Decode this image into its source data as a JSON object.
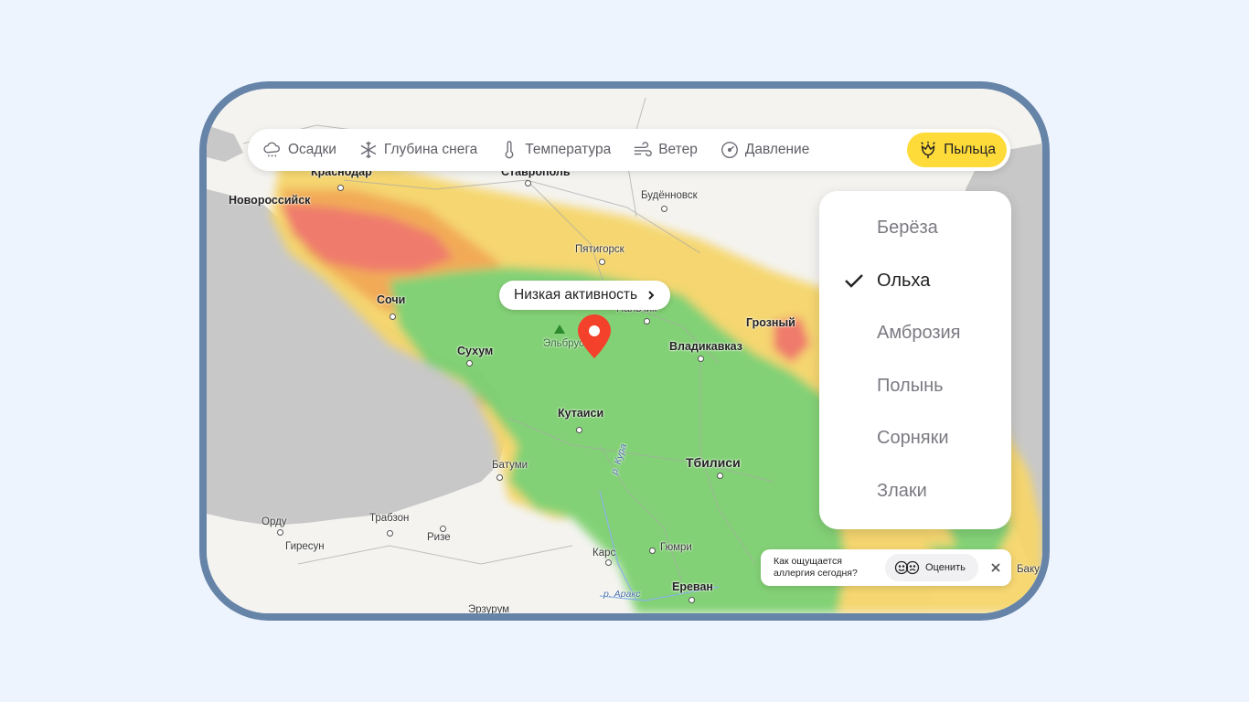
{
  "layers": [
    {
      "label": "Осадки",
      "icon": "cloud-rain-icon"
    },
    {
      "label": "Глубина снега",
      "icon": "snowflake-icon"
    },
    {
      "label": "Температура",
      "icon": "thermometer-icon"
    },
    {
      "label": "Ветер",
      "icon": "wind-icon"
    },
    {
      "label": "Давление",
      "icon": "gauge-icon"
    },
    {
      "label": "Пыльца",
      "icon": "pollen-flower-icon",
      "active": true
    }
  ],
  "popup": {
    "label": "Низкая активность"
  },
  "pollen_menu": {
    "items": [
      "Берёза",
      "Ольха",
      "Амброзия",
      "Полынь",
      "Сорняки",
      "Злаки"
    ],
    "selected": "Ольха"
  },
  "feedback": {
    "question": "Как ощущается аллергия сегодня?",
    "button": "Оценить"
  },
  "map_labels": {
    "krasnodar": "Краснодар",
    "stavropol": "Ставрополь",
    "novorossiysk": "Новороссийск",
    "budennovsk": "Будённовск",
    "pyatigorsk": "Пятигорск",
    "sochi": "Сочи",
    "nalchik": "Нальчик",
    "grozny": "Грозный",
    "elbrus": "Эльбрус",
    "vladikavkaz": "Владикавказ",
    "sukhum": "Сухум",
    "kutaisi": "Кутаиси",
    "tbilisi": "Тбилиси",
    "batumi": "Батуми",
    "ordu": "Орду",
    "trabzon": "Трабзон",
    "giresun": "Гиресун",
    "rize": "Ризе",
    "kars": "Карс",
    "gyumri": "Гюмри",
    "yerevan": "Ереван",
    "erzurum": "Эрзурум",
    "baku": "Баку",
    "river_aras": "р. Аракс",
    "river_kura": "р. Кура"
  },
  "colors": {
    "low": "#7dd06f",
    "medium": "#f6d56b",
    "high": "#f2a750",
    "very_high": "#ef7565",
    "sea": "#c8c8c8",
    "accent": "#ffdb3a",
    "pin": "#f4412b"
  }
}
